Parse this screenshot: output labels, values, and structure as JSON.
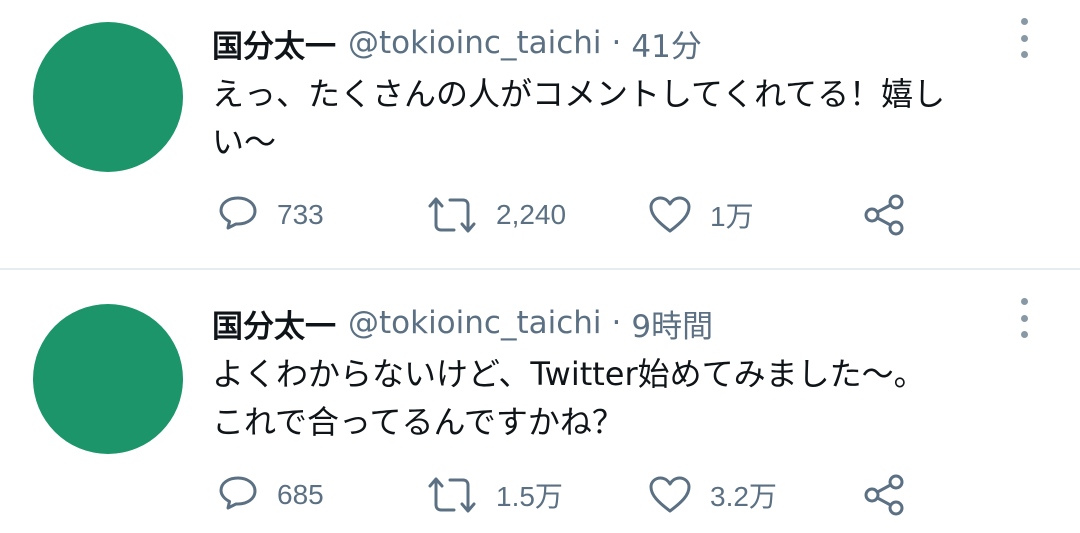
{
  "colors": {
    "avatar": "#1b9569",
    "text": "#0f1419",
    "muted": "#5b7083",
    "divider": "#e6ecf0"
  },
  "tweets": [
    {
      "name": "国分太一",
      "handle": "@tokioinc_taichi",
      "separator": "·",
      "time": "41分",
      "text_lines": [
        "えっ、たくさんの人がコメントしてくれてる！嬉し",
        "い〜"
      ],
      "replies": "733",
      "retweets": "2,240",
      "likes": "1万",
      "icons": [
        "comment-icon",
        "retweet-icon",
        "heart-icon",
        "share-icon",
        "more-options-icon"
      ]
    },
    {
      "name": "国分太一",
      "handle": "@tokioinc_taichi",
      "separator": "·",
      "time": "9時間",
      "text_lines": [
        "よくわからないけど、Twitter始めてみました〜。",
        "これで合ってるんですかね？"
      ],
      "replies": "685",
      "retweets": "1.5万",
      "likes": "3.2万",
      "icons": [
        "comment-icon",
        "retweet-icon",
        "heart-icon",
        "share-icon",
        "more-options-icon"
      ]
    }
  ]
}
